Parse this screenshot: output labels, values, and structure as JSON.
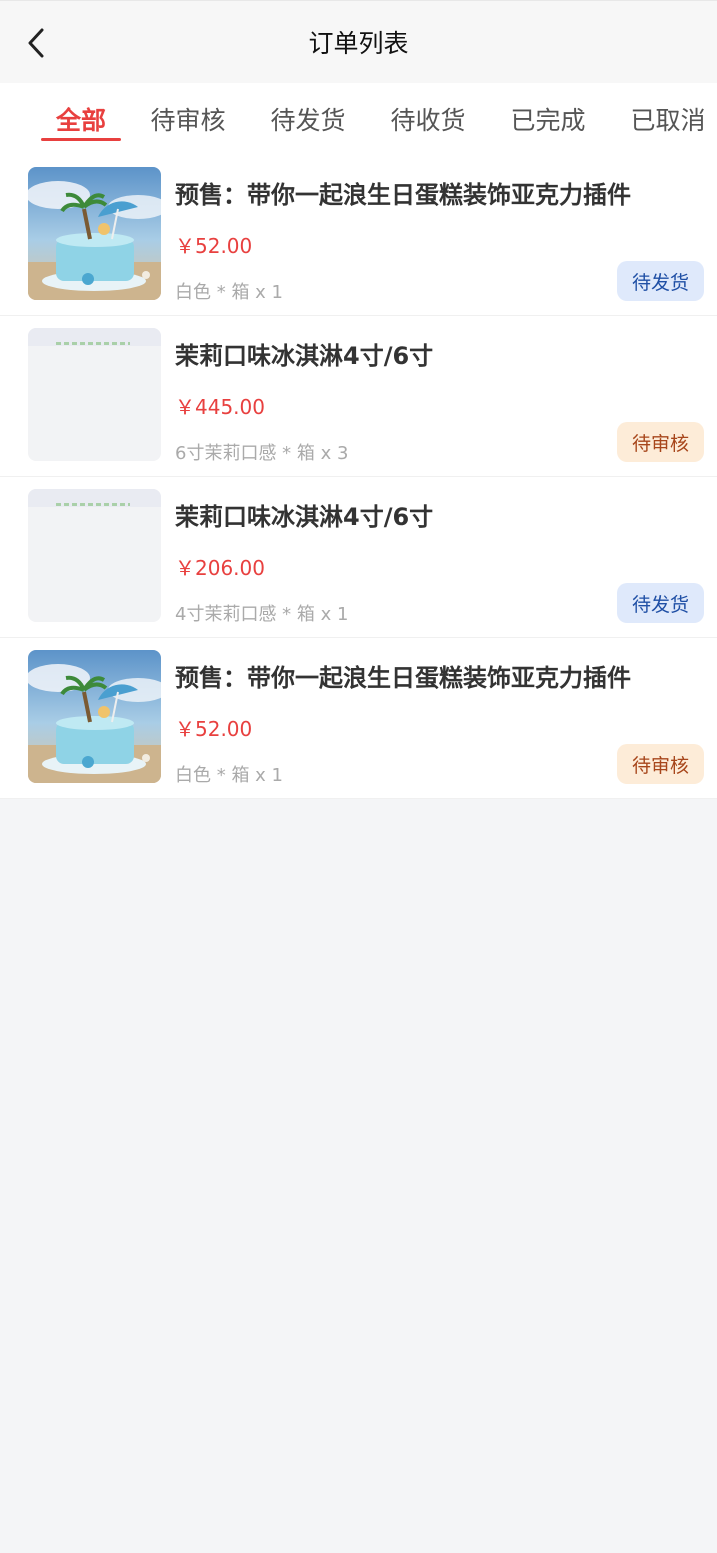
{
  "header": {
    "title": "订单列表"
  },
  "tabs": [
    {
      "label": "全部",
      "active": true
    },
    {
      "label": "待审核",
      "active": false
    },
    {
      "label": "待发货",
      "active": false
    },
    {
      "label": "待收货",
      "active": false
    },
    {
      "label": "已完成",
      "active": false
    },
    {
      "label": "已取消",
      "active": false
    }
  ],
  "orders": [
    {
      "name": "预售：带你一起浪生日蛋糕装饰亚克力插件",
      "price": "￥52.00",
      "spec": "白色 * 箱 x 1",
      "status": "待发货",
      "image": "cake-photo"
    },
    {
      "name": "茉莉口味冰淇淋4寸/6寸",
      "price": "￥445.00",
      "spec": "6寸茉莉口感 * 箱 x 3",
      "status": "待审核",
      "image": "placeholder"
    },
    {
      "name": "茉莉口味冰淇淋4寸/6寸",
      "price": "￥206.00",
      "spec": "4寸茉莉口感 * 箱 x 1",
      "status": "待发货",
      "image": "placeholder"
    },
    {
      "name": "预售：带你一起浪生日蛋糕装饰亚克力插件",
      "price": "￥52.00",
      "spec": "白色 * 箱 x 1",
      "status": "待审核",
      "image": "cake-photo"
    }
  ],
  "colors": {
    "accent": "#e8403f",
    "ship_badge_bg": "#dfe9fb",
    "review_badge_bg": "#fdecd8"
  }
}
